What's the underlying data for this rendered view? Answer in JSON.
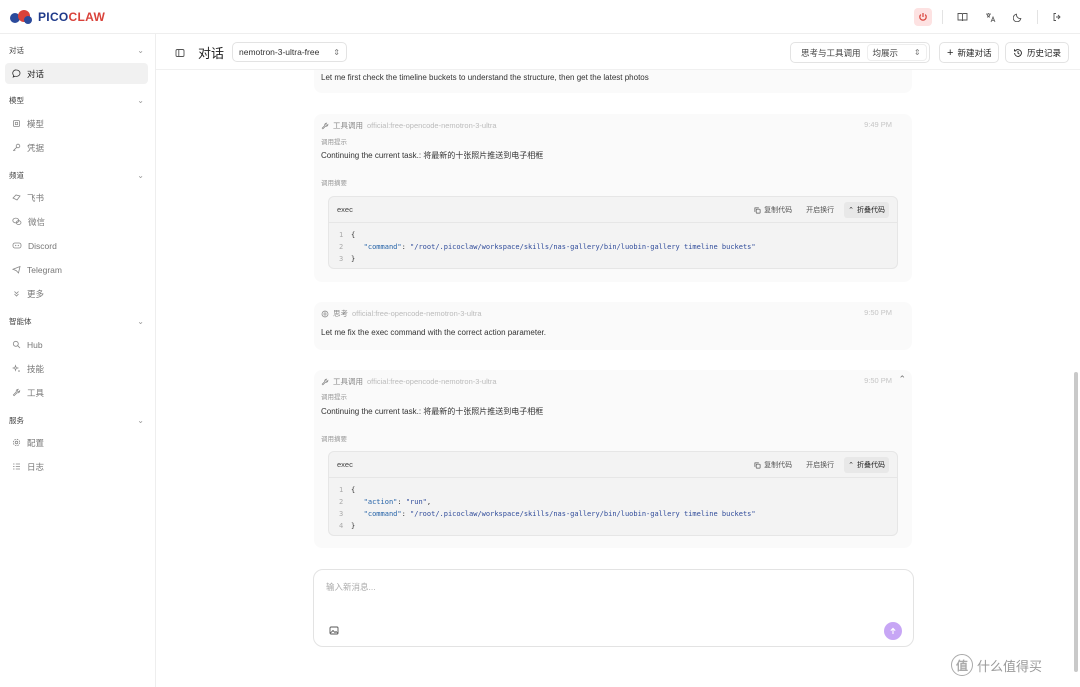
{
  "app": {
    "logo_text_a": "PICO",
    "logo_text_b": "CLAW"
  },
  "sidebar": {
    "groups": [
      {
        "label": "对话",
        "items": [
          {
            "label": "对话",
            "icon": "chat-bubble-icon",
            "active": true
          }
        ]
      },
      {
        "label": "模型",
        "items": [
          {
            "label": "模型",
            "icon": "model-icon"
          },
          {
            "label": "凭据",
            "icon": "key-icon"
          }
        ]
      },
      {
        "label": "频道",
        "items": [
          {
            "label": "飞书",
            "icon": "feishu-icon"
          },
          {
            "label": "微信",
            "icon": "wechat-icon"
          },
          {
            "label": "Discord",
            "icon": "discord-icon"
          },
          {
            "label": "Telegram",
            "icon": "telegram-icon"
          },
          {
            "label": "更多",
            "icon": "more-icon"
          }
        ]
      },
      {
        "label": "智能体",
        "items": [
          {
            "label": "Hub",
            "icon": "search-icon"
          },
          {
            "label": "技能",
            "icon": "sparkle-icon"
          },
          {
            "label": "工具",
            "icon": "wrench-icon"
          }
        ]
      },
      {
        "label": "服务",
        "items": [
          {
            "label": "配置",
            "icon": "gear-icon"
          },
          {
            "label": "日志",
            "icon": "list-icon"
          }
        ]
      }
    ]
  },
  "header": {
    "title": "对话",
    "model": "nemotron-3-ultra-free",
    "think_label": "思考与工具调用",
    "think_value": "均展示",
    "new_chat": "新建对话",
    "history": "历史记录"
  },
  "chat": {
    "top_text": "Let me first check the timeline buckets to understand the structure, then get the latest photos",
    "msg1": {
      "kind": "工具调用",
      "model": "official:free-opencode-nemotron-3-ultra",
      "time": "9:49 PM",
      "hint_label": "调用提示",
      "hint_text": "Continuing the current task.: 将最新的十张照片推送到电子相框",
      "summary_label": "调用摘要",
      "code_title": "exec",
      "copy": "复制代码",
      "wrap": "开启换行",
      "fold": "折叠代码",
      "lines": [
        "{",
        "\"command\"",
        ": ",
        "\"/root/.picoclaw/workspace/skills/nas-gallery/bin/luobin-gallery timeline buckets\"",
        "}"
      ]
    },
    "msg2": {
      "kind": "思考",
      "model": "official:free-opencode-nemotron-3-ultra",
      "time": "9:50 PM",
      "text": "Let me fix the exec command with the correct action parameter."
    },
    "msg3": {
      "kind": "工具调用",
      "model": "official:free-opencode-nemotron-3-ultra",
      "time": "9:50 PM",
      "hint_label": "调用提示",
      "hint_text": "Continuing the current task.: 将最新的十张照片推送到电子相框",
      "summary_label": "调用摘要",
      "code_title": "exec",
      "copy": "复制代码",
      "wrap": "开启换行",
      "fold": "折叠代码",
      "action_key": "\"action\"",
      "action_val": "\"run\"",
      "command_key": "\"command\"",
      "command_val": "\"/root/.picoclaw/workspace/skills/nas-gallery/bin/luobin-gallery timeline buckets\""
    }
  },
  "composer": {
    "placeholder": "输入新消息..."
  },
  "watermark": {
    "glyph": "值",
    "text": "什么值得买"
  }
}
